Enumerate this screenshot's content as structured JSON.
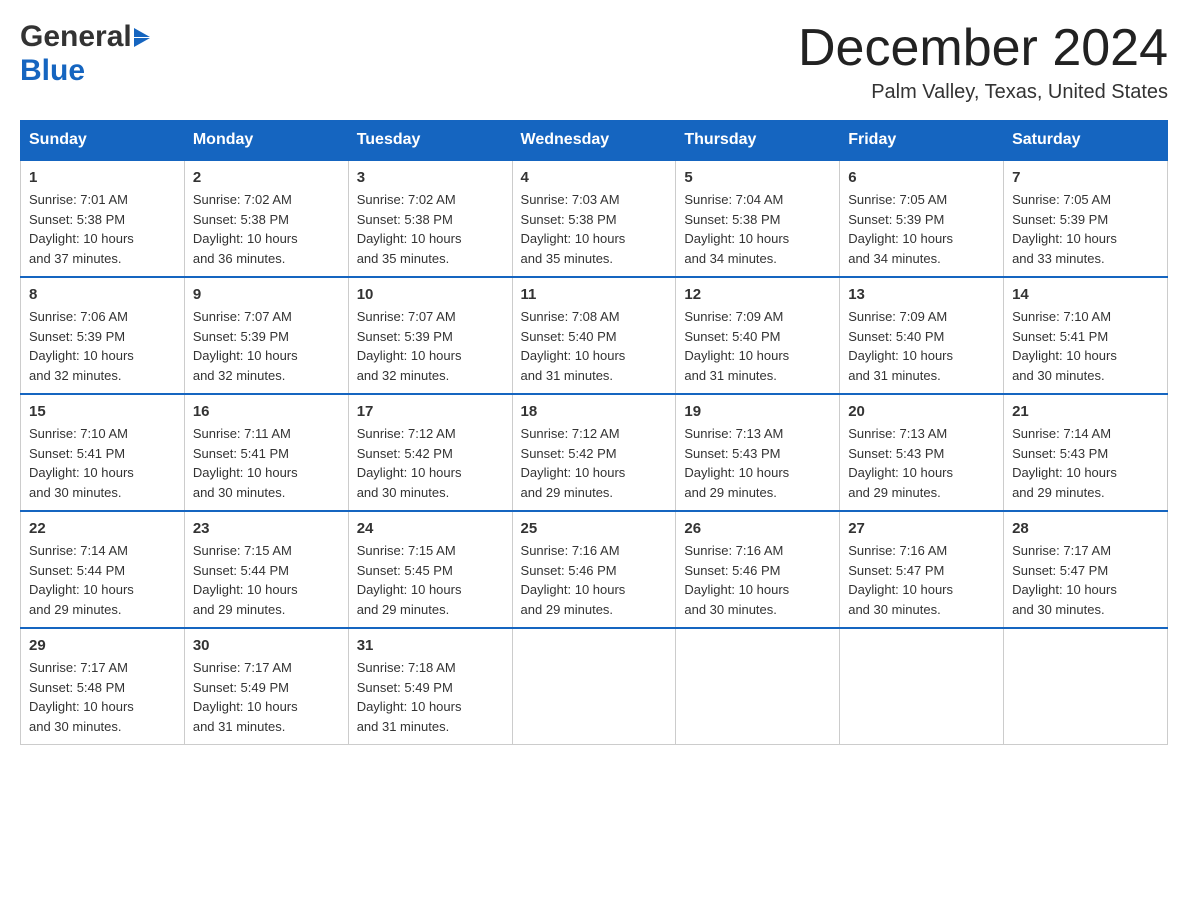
{
  "header": {
    "logo_general": "General",
    "logo_blue": "Blue",
    "month_year": "December 2024",
    "location": "Palm Valley, Texas, United States"
  },
  "days_of_week": [
    "Sunday",
    "Monday",
    "Tuesday",
    "Wednesday",
    "Thursday",
    "Friday",
    "Saturday"
  ],
  "weeks": [
    [
      {
        "day": "1",
        "sunrise": "7:01 AM",
        "sunset": "5:38 PM",
        "daylight": "10 hours and 37 minutes."
      },
      {
        "day": "2",
        "sunrise": "7:02 AM",
        "sunset": "5:38 PM",
        "daylight": "10 hours and 36 minutes."
      },
      {
        "day": "3",
        "sunrise": "7:02 AM",
        "sunset": "5:38 PM",
        "daylight": "10 hours and 35 minutes."
      },
      {
        "day": "4",
        "sunrise": "7:03 AM",
        "sunset": "5:38 PM",
        "daylight": "10 hours and 35 minutes."
      },
      {
        "day": "5",
        "sunrise": "7:04 AM",
        "sunset": "5:38 PM",
        "daylight": "10 hours and 34 minutes."
      },
      {
        "day": "6",
        "sunrise": "7:05 AM",
        "sunset": "5:39 PM",
        "daylight": "10 hours and 34 minutes."
      },
      {
        "day": "7",
        "sunrise": "7:05 AM",
        "sunset": "5:39 PM",
        "daylight": "10 hours and 33 minutes."
      }
    ],
    [
      {
        "day": "8",
        "sunrise": "7:06 AM",
        "sunset": "5:39 PM",
        "daylight": "10 hours and 32 minutes."
      },
      {
        "day": "9",
        "sunrise": "7:07 AM",
        "sunset": "5:39 PM",
        "daylight": "10 hours and 32 minutes."
      },
      {
        "day": "10",
        "sunrise": "7:07 AM",
        "sunset": "5:39 PM",
        "daylight": "10 hours and 32 minutes."
      },
      {
        "day": "11",
        "sunrise": "7:08 AM",
        "sunset": "5:40 PM",
        "daylight": "10 hours and 31 minutes."
      },
      {
        "day": "12",
        "sunrise": "7:09 AM",
        "sunset": "5:40 PM",
        "daylight": "10 hours and 31 minutes."
      },
      {
        "day": "13",
        "sunrise": "7:09 AM",
        "sunset": "5:40 PM",
        "daylight": "10 hours and 31 minutes."
      },
      {
        "day": "14",
        "sunrise": "7:10 AM",
        "sunset": "5:41 PM",
        "daylight": "10 hours and 30 minutes."
      }
    ],
    [
      {
        "day": "15",
        "sunrise": "7:10 AM",
        "sunset": "5:41 PM",
        "daylight": "10 hours and 30 minutes."
      },
      {
        "day": "16",
        "sunrise": "7:11 AM",
        "sunset": "5:41 PM",
        "daylight": "10 hours and 30 minutes."
      },
      {
        "day": "17",
        "sunrise": "7:12 AM",
        "sunset": "5:42 PM",
        "daylight": "10 hours and 30 minutes."
      },
      {
        "day": "18",
        "sunrise": "7:12 AM",
        "sunset": "5:42 PM",
        "daylight": "10 hours and 29 minutes."
      },
      {
        "day": "19",
        "sunrise": "7:13 AM",
        "sunset": "5:43 PM",
        "daylight": "10 hours and 29 minutes."
      },
      {
        "day": "20",
        "sunrise": "7:13 AM",
        "sunset": "5:43 PM",
        "daylight": "10 hours and 29 minutes."
      },
      {
        "day": "21",
        "sunrise": "7:14 AM",
        "sunset": "5:43 PM",
        "daylight": "10 hours and 29 minutes."
      }
    ],
    [
      {
        "day": "22",
        "sunrise": "7:14 AM",
        "sunset": "5:44 PM",
        "daylight": "10 hours and 29 minutes."
      },
      {
        "day": "23",
        "sunrise": "7:15 AM",
        "sunset": "5:44 PM",
        "daylight": "10 hours and 29 minutes."
      },
      {
        "day": "24",
        "sunrise": "7:15 AM",
        "sunset": "5:45 PM",
        "daylight": "10 hours and 29 minutes."
      },
      {
        "day": "25",
        "sunrise": "7:16 AM",
        "sunset": "5:46 PM",
        "daylight": "10 hours and 29 minutes."
      },
      {
        "day": "26",
        "sunrise": "7:16 AM",
        "sunset": "5:46 PM",
        "daylight": "10 hours and 30 minutes."
      },
      {
        "day": "27",
        "sunrise": "7:16 AM",
        "sunset": "5:47 PM",
        "daylight": "10 hours and 30 minutes."
      },
      {
        "day": "28",
        "sunrise": "7:17 AM",
        "sunset": "5:47 PM",
        "daylight": "10 hours and 30 minutes."
      }
    ],
    [
      {
        "day": "29",
        "sunrise": "7:17 AM",
        "sunset": "5:48 PM",
        "daylight": "10 hours and 30 minutes."
      },
      {
        "day": "30",
        "sunrise": "7:17 AM",
        "sunset": "5:49 PM",
        "daylight": "10 hours and 31 minutes."
      },
      {
        "day": "31",
        "sunrise": "7:18 AM",
        "sunset": "5:49 PM",
        "daylight": "10 hours and 31 minutes."
      },
      null,
      null,
      null,
      null
    ]
  ],
  "labels": {
    "sunrise": "Sunrise:",
    "sunset": "Sunset:",
    "daylight": "Daylight:"
  }
}
